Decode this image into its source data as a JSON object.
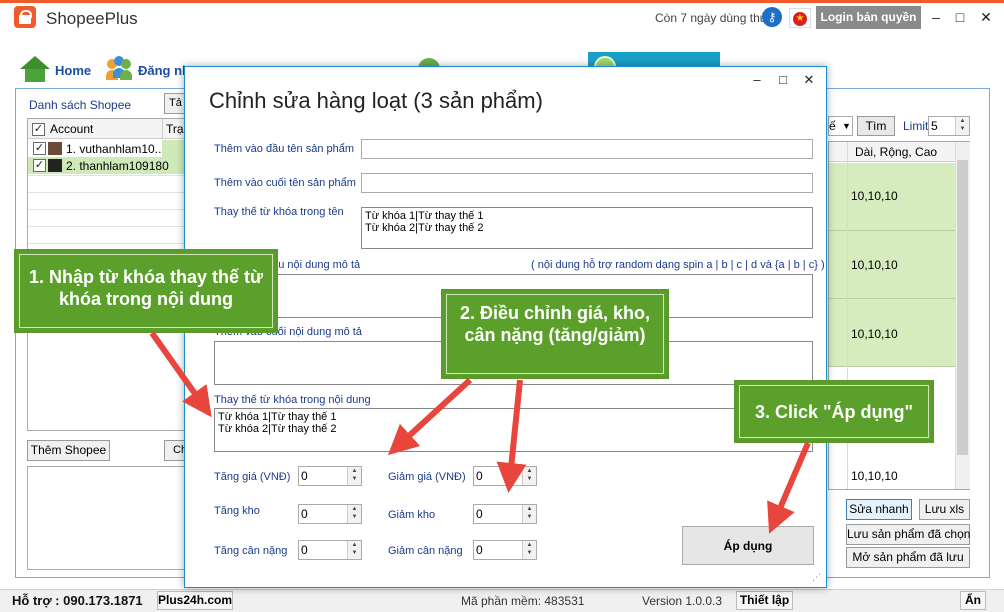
{
  "window": {
    "title": "ShopeePlus",
    "trial_text": "Còn 7 ngày dùng thử",
    "login_button": "Login bản quyền",
    "minimize": "–",
    "maximize": "□",
    "close": "✕"
  },
  "nav": {
    "home": "Home",
    "login": "Đăng nh"
  },
  "account_panel": {
    "label": "Danh sách Shopee",
    "cut_button": "Tả",
    "col_account": "Account",
    "col_status": "Trạ",
    "accounts": [
      {
        "checked": "✓",
        "name": "1. vuthanhlam10..."
      },
      {
        "checked": "✓",
        "name": "2. thanhlam109180"
      }
    ],
    "add_button": "Thêm Shopee",
    "cut_button2": "Ch"
  },
  "product_panel": {
    "combo_value": "ế",
    "search_button": "Tìm",
    "limit_label": "Limit:",
    "limit_value": "5",
    "col_dims": "Dài, Rộng, Cao",
    "rows": [
      "10,10,10",
      "10,10,10",
      "10,10,10",
      "10,10,10"
    ],
    "buttons": {
      "quick_edit": "Sửa nhanh",
      "save_xls": "Lưu xls",
      "save_selected": "Lưu sản phẩm đã chọn",
      "open_saved": "Mở sản phẩm đã lưu"
    }
  },
  "status_bar": {
    "support": "Hỗ trợ : 090.173.1871",
    "website": "Plus24h.com",
    "software_code": "Mã phần mềm: 483531",
    "version": "Version 1.0.0.3",
    "settings": "Thiết lập",
    "hide": "Ẩn"
  },
  "dialog": {
    "title": "Chỉnh sửa hàng loạt (3 sản phẩm)",
    "minimize": "–",
    "maximize": "□",
    "close": "✕",
    "prefix_name_label": "Thêm vào đầu tên sản phẩm",
    "suffix_name_label": "Thêm vào cuối tên sản phẩm",
    "replace_name_label": "Thay thế từ khóa trong tên",
    "replace_name_value": "Từ khóa 1|Từ thay thế 1\nTừ khóa 2|Từ thay thế 2",
    "prefix_desc_label": "Thêm vào đầu nội dung mô tả",
    "spin_hint": "( nội dung hỗ trợ random dạng spin a | b | c | d và {a | b | c} )",
    "suffix_desc_label": "Thêm vào cuối nội dung mô tả",
    "replace_desc_label": "Thay thế từ khóa trong nội dung",
    "replace_desc_value": "Từ khóa 1|Từ thay thế 1\nTừ khóa 2|Từ thay thế 2",
    "price_up_label": "Tăng giá (VNĐ)",
    "price_up_value": "0",
    "price_down_label": "Giảm giá (VNĐ)",
    "price_down_value": "0",
    "stock_up_label": "Tăng kho",
    "stock_up_value": "0",
    "stock_down_label": "Giảm kho",
    "stock_down_value": "0",
    "weight_up_label": "Tăng cân nặng",
    "weight_up_value": "0",
    "weight_down_label": "Giảm cân nặng",
    "weight_down_value": "0",
    "apply_button": "Áp dụng"
  },
  "callouts": {
    "step1": "1. Nhập từ khóa thay thế từ khóa trong nội dung",
    "step2": "2. Điều chỉnh giá, kho, cân nặng (tăng/giảm)",
    "step3": "3. Click \"Áp dụng\""
  },
  "colors": {
    "brand": "#f25a29",
    "callout_green": "#5aa02a",
    "arrow_red": "#e8453c",
    "row_green": "#d7ecbe",
    "dialog_border": "#1a8fd0"
  },
  "icons": [
    "shopee-bag-icon",
    "key-icon",
    "vietnam-flag-icon",
    "home-icon",
    "users-icon",
    "resize-grip-icon"
  ]
}
